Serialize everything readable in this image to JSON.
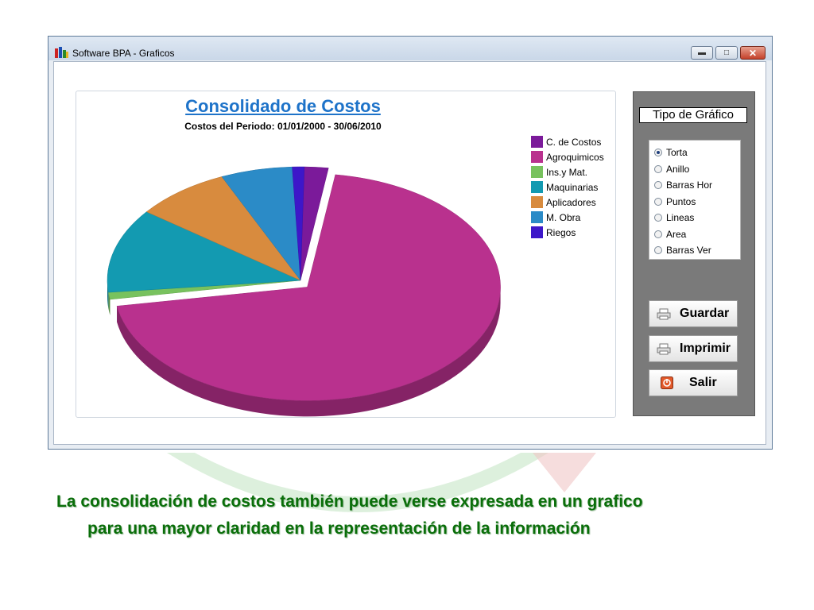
{
  "window": {
    "title": "Software BPA - Graficos"
  },
  "chart_data": {
    "type": "pie",
    "title": "Consolidado de Costos",
    "subtitle": "Costos del Periodo: 01/01/2000 - 30/06/2010",
    "legend_position": "right",
    "exploded": "Agroquimicos",
    "slices": [
      {
        "label": "C. de Costos",
        "value": 2,
        "color": "#7b1a9a"
      },
      {
        "label": "Agroquimicos",
        "value": 70,
        "color": "#b9318e"
      },
      {
        "label": "Ins.y Mat.",
        "value": 1,
        "color": "#78c25e"
      },
      {
        "label": "Maquinarias",
        "value": 12,
        "color": "#139ab1"
      },
      {
        "label": "Aplicadores",
        "value": 8,
        "color": "#d88b3e"
      },
      {
        "label": "M. Obra",
        "value": 6,
        "color": "#2b8bc7"
      },
      {
        "label": "Riegos",
        "value": 1,
        "color": "#3d17c9"
      }
    ]
  },
  "panel": {
    "title": "Tipo de Gráfico",
    "options": [
      {
        "label": "Torta",
        "checked": true
      },
      {
        "label": "Anillo",
        "checked": false
      },
      {
        "label": "Barras Hor",
        "checked": false
      },
      {
        "label": "Puntos",
        "checked": false
      },
      {
        "label": "Lineas",
        "checked": false
      },
      {
        "label": "Area",
        "checked": false
      },
      {
        "label": "Barras Ver",
        "checked": false
      }
    ],
    "buttons": {
      "save": "Guardar",
      "print": "Imprimir",
      "exit": "Salir"
    }
  },
  "caption": {
    "line1": "La consolidación de costos también puede verse expresada en un grafico",
    "line2": "para una mayor claridad en la representación de la información"
  },
  "colors": {
    "caption": "#0a6e0a",
    "title": "#1e73c9",
    "panel": "#7a7a7a"
  }
}
